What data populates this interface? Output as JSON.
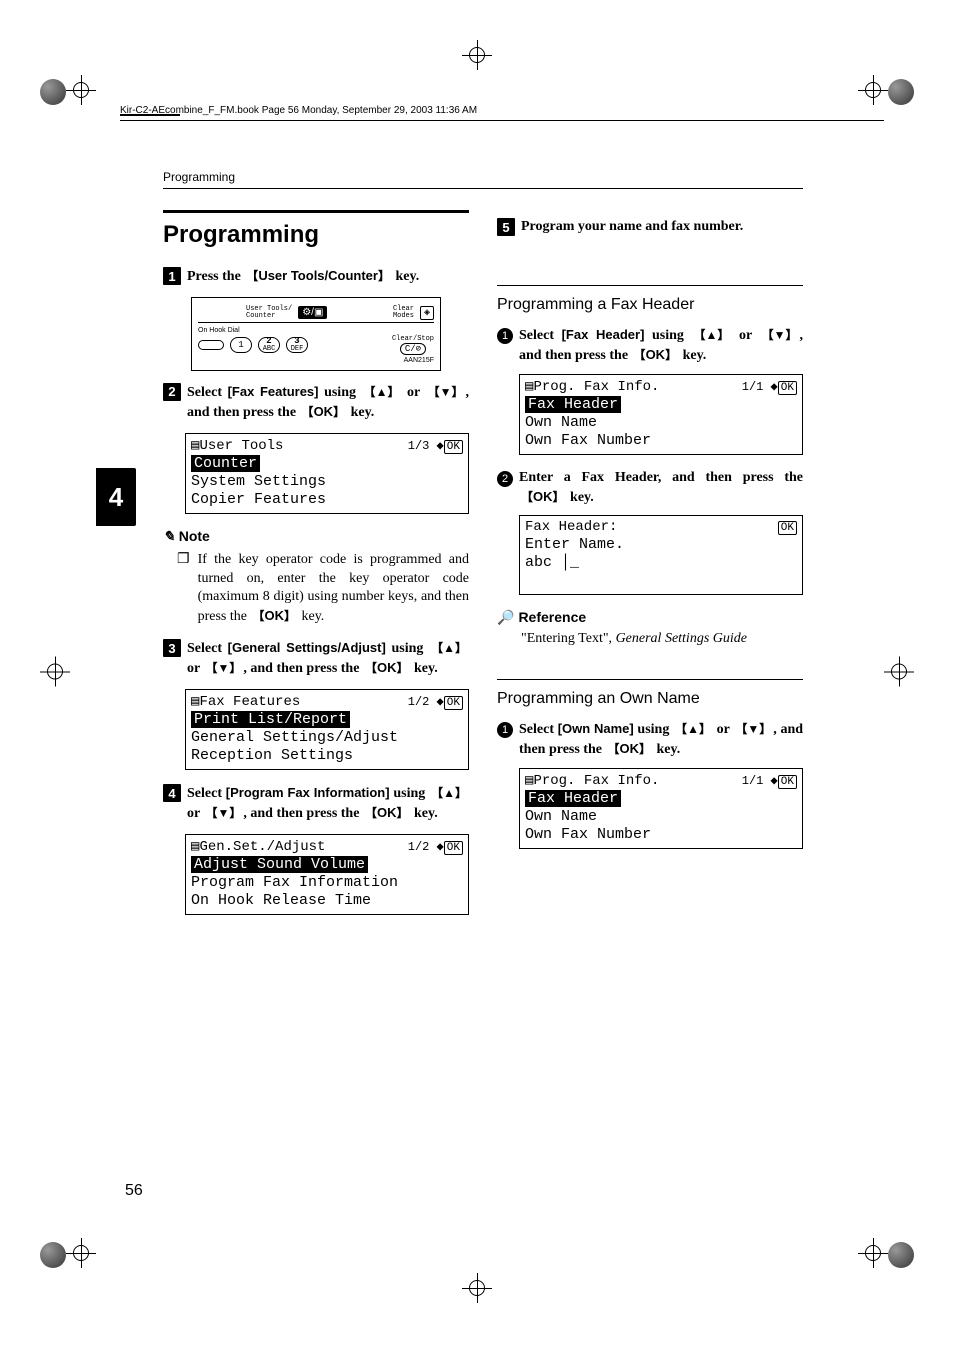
{
  "header_line": "Kir-C2-AEcombine_F_FM.book  Page 56  Monday, September 29, 2003  11:36 AM",
  "running_head": "Programming",
  "section_title": "Programming",
  "tab_number": "4",
  "page_number": "56",
  "steps": {
    "s1": {
      "text_b": "Press the ",
      "key": "User Tools/Counter",
      "text_a": " key."
    },
    "s2": {
      "text_b": "Select ",
      "opt": "[Fax Features]",
      "mid": " using ",
      "up": "▲",
      "or": " or ",
      "down": "▼",
      "mid2": ", and then press the ",
      "ok": "OK",
      "text_a": " key."
    },
    "s3": {
      "text_b": " Select ",
      "opt": "[General Settings/Adjust]",
      "mid": " using ",
      "up": "▲",
      "or": " or ",
      "down": "▼",
      "mid2": ", and then press the ",
      "ok": "OK",
      "text_a": " key."
    },
    "s4": {
      "text_b": "Select ",
      "opt": "[Program Fax Information]",
      "mid": " using ",
      "up": "▲",
      "or": " or ",
      "down": "▼",
      "mid2": ", and then press the ",
      "ok": "OK",
      "text_a": " key."
    },
    "s5": {
      "text": "Program your name and fax number."
    }
  },
  "panel": {
    "usr_lbl": "User Tools/\nCounter",
    "clr_lbl": "Clear\nModes",
    "hook": "On Hook Dial",
    "k1": "1",
    "k2": "2",
    "k2s": "ABC",
    "k3": "3",
    "k3s": "DEF",
    "clrstop": "Clear/Stop",
    "code": "AAN215F"
  },
  "lcd1": {
    "title": "User Tools",
    "page": "1/3",
    "l1": "Counter",
    "l2": "System Settings",
    "l3": "Copier Features"
  },
  "note_label": "Note",
  "note_text": "If the key operator code is programmed and turned on, enter the key operator code (maximum 8 digit) using number keys, and then press the ",
  "note_ok": "OK",
  "note_after": " key.",
  "lcd2": {
    "title": "Fax Features",
    "page": "1/2",
    "l1": "Print List/Report",
    "l2": "General Settings/Adjust",
    "l3": "Reception Settings"
  },
  "lcd3": {
    "title": "Gen.Set./Adjust",
    "page": "1/2",
    "l1": "Adjust Sound Volume",
    "l2": "Program Fax Information",
    "l3": "On Hook Release Time"
  },
  "subA": {
    "title": "Programming a Fax Header",
    "c1": {
      "text_b": "Select ",
      "opt": "[Fax Header]",
      "mid": " using ",
      "up": "▲",
      "or": " or ",
      "down": "▼",
      "mid2": ", and then press the ",
      "ok": "OK",
      "text_a": " key."
    },
    "lcd": {
      "title": "Prog. Fax Info.",
      "page": "1/1",
      "l1": "Fax Header",
      "l2": "Own Name",
      "l3": "Own Fax Number"
    },
    "c2": {
      "text_b": "Enter a Fax Header, and then press the ",
      "ok": "OK",
      "text_a": " key."
    },
    "lcd2": {
      "l1": "Fax Header:",
      "l2": "Enter Name.",
      "l3": "abc",
      "cursor": "_"
    }
  },
  "ref_label": "Reference",
  "ref_body_a": "\"Entering Text\", ",
  "ref_body_b": "General Settings Guide",
  "subB": {
    "title": "Programming an Own Name",
    "c1": {
      "text_b": "Select ",
      "opt": "[Own Name]",
      "mid": " using ",
      "up": "▲",
      "or": " or ",
      "down": "▼",
      "mid2": ", and then press the ",
      "ok": "OK",
      "text_a": " key."
    },
    "lcd": {
      "title": "Prog. Fax Info.",
      "page": "1/1",
      "l1": "Fax Header",
      "l2": "Own Name",
      "l3": "Own Fax Number"
    }
  }
}
